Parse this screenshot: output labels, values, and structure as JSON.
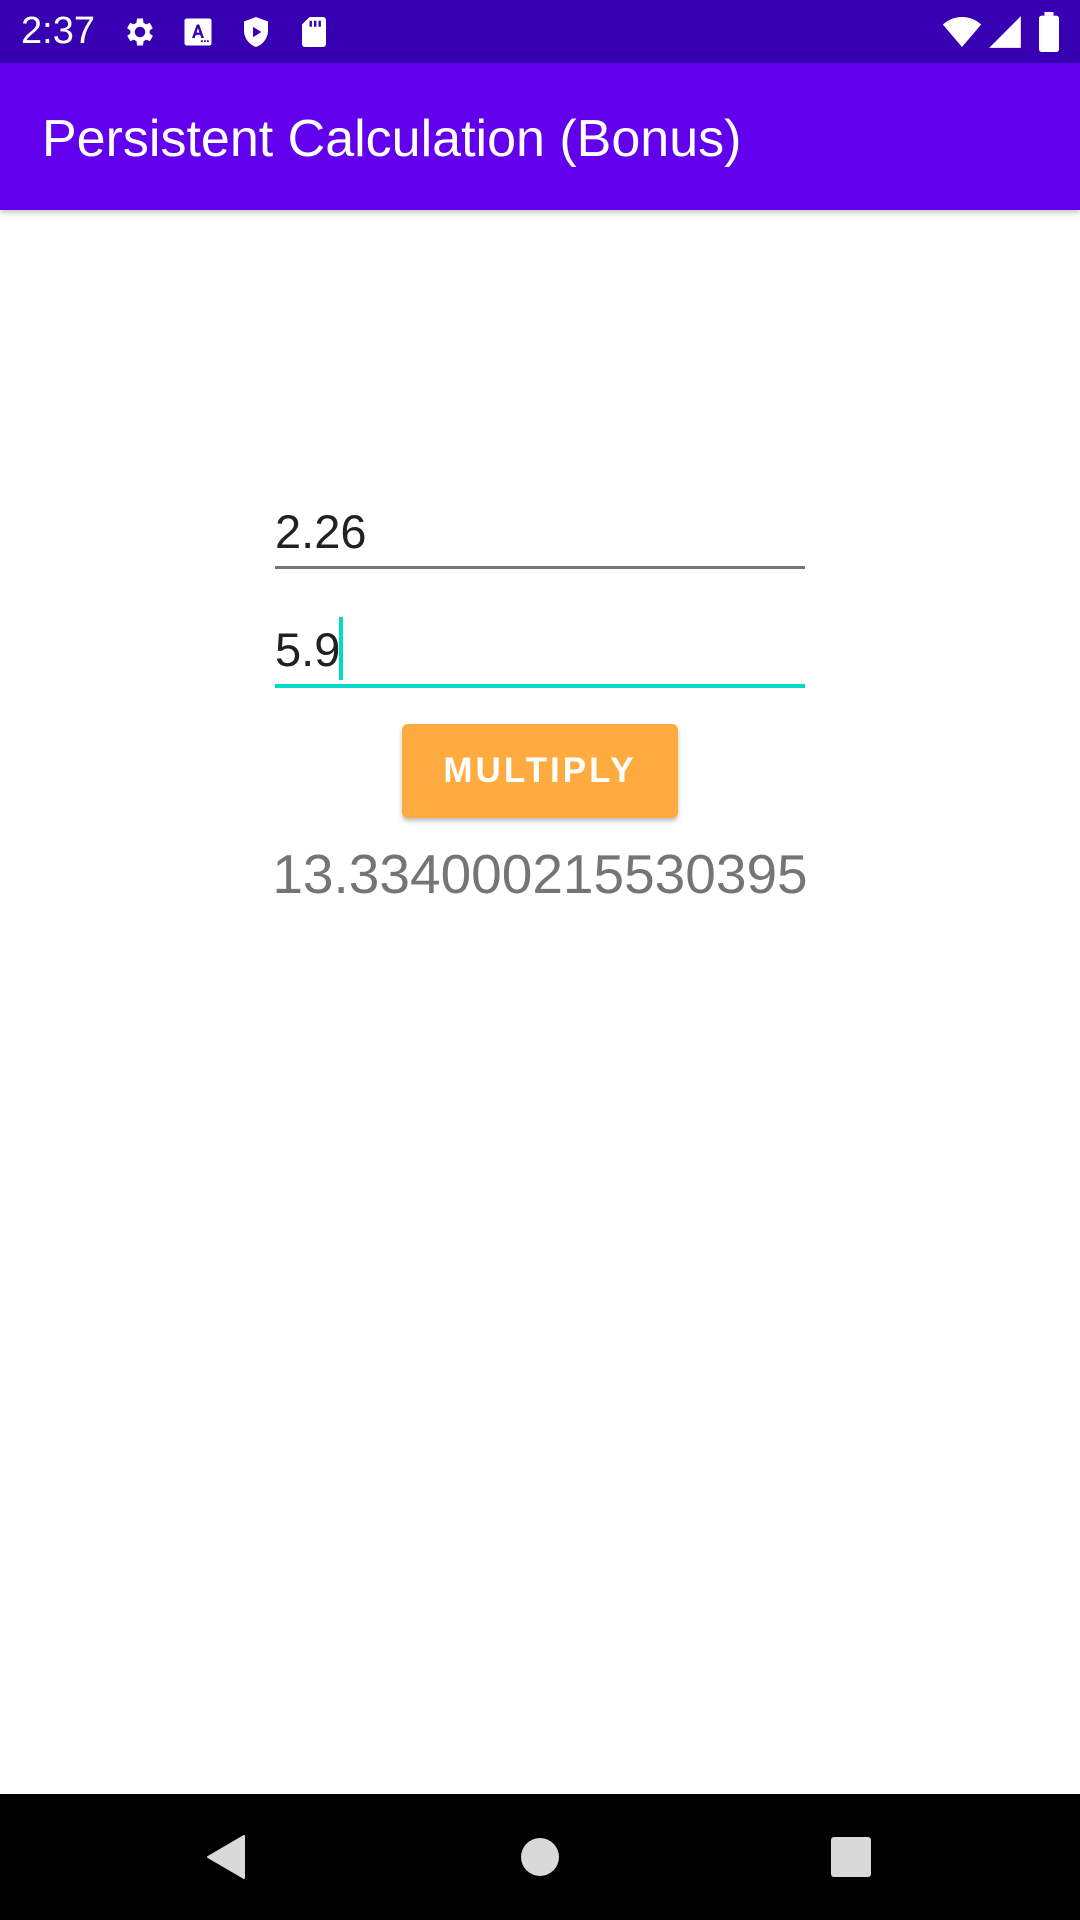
{
  "status_bar": {
    "time": "2:37",
    "icons": [
      "settings-icon",
      "font-a-icon",
      "play-shield-icon",
      "sd-card-icon",
      "wifi-icon",
      "cell-signal-icon",
      "battery-icon"
    ],
    "background": "#3700B3"
  },
  "app_bar": {
    "title": "Persistent Calculation (Bonus)",
    "background": "#6200EE"
  },
  "main": {
    "first_number": "2.26",
    "second_number": "5.9",
    "multiply_label": "MULTIPLY",
    "result": "13.334000215530395",
    "accent": "#03DAC5",
    "button_color": "#FFAB40"
  },
  "nav_bar": {
    "buttons": [
      "back-icon",
      "home-icon",
      "recents-icon"
    ]
  }
}
